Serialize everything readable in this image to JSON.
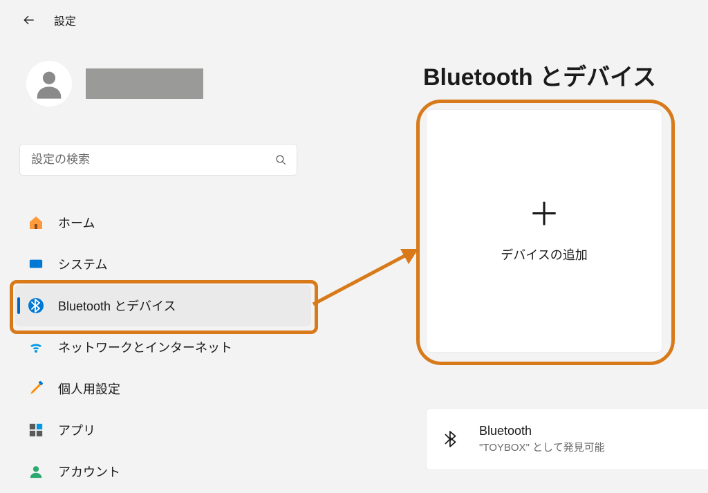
{
  "header": {
    "title": "設定"
  },
  "search": {
    "placeholder": "設定の検索"
  },
  "nav": {
    "items": [
      {
        "key": "home",
        "label": "ホーム"
      },
      {
        "key": "system",
        "label": "システム"
      },
      {
        "key": "bt",
        "label": "Bluetooth とデバイス",
        "selected": true
      },
      {
        "key": "network",
        "label": "ネットワークとインターネット"
      },
      {
        "key": "personal",
        "label": "個人用設定"
      },
      {
        "key": "apps",
        "label": "アプリ"
      },
      {
        "key": "account",
        "label": "アカウント"
      }
    ]
  },
  "main": {
    "title": "Bluetooth とデバイス",
    "add_device": "デバイスの追加",
    "bt_row": {
      "title": "Bluetooth",
      "subtitle": "\"TOYBOX\" として発見可能"
    }
  },
  "colors": {
    "accent": "#0067c0",
    "callout": "#d87a1a"
  }
}
